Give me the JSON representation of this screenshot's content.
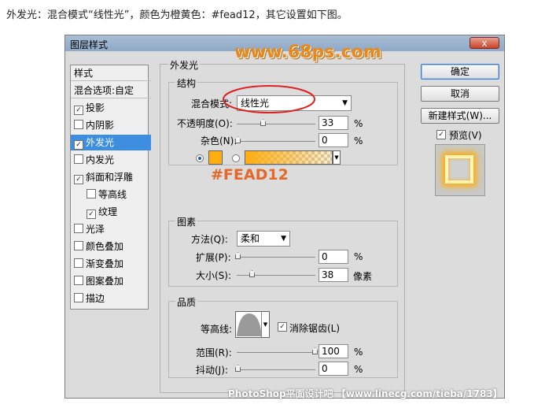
{
  "caption": "外发光：混合模式“线性光”，颜色为橙黄色：#fead12，其它设置如下图。",
  "dialog": {
    "title": "图层样式",
    "close_label": "x"
  },
  "sidebar": {
    "header": "样式",
    "blend_options": "混合选项:自定",
    "items": [
      {
        "label": "投影",
        "checked": "✓"
      },
      {
        "label": "内阴影",
        "checked": ""
      },
      {
        "label": "外发光",
        "checked": "✓"
      },
      {
        "label": "内发光",
        "checked": ""
      },
      {
        "label": "斜面和浮雕",
        "checked": "✓"
      },
      {
        "label": "等高线",
        "checked": ""
      },
      {
        "label": "纹理",
        "checked": "✓"
      },
      {
        "label": "光泽",
        "checked": ""
      },
      {
        "label": "颜色叠加",
        "checked": ""
      },
      {
        "label": "渐变叠加",
        "checked": ""
      },
      {
        "label": "图案叠加",
        "checked": ""
      },
      {
        "label": "描边",
        "checked": ""
      }
    ]
  },
  "panel": {
    "title": "外发光",
    "structure": {
      "title": "结构",
      "blend_mode_label": "混合模式:",
      "blend_mode_value": "线性光",
      "opacity_label": "不透明度(O):",
      "opacity_value": "33",
      "noise_label": "杂色(N):",
      "noise_value": "0",
      "percent": "%"
    },
    "elements": {
      "title": "图素",
      "method_label": "方法(Q):",
      "method_value": "柔和",
      "spread_label": "扩展(P):",
      "spread_value": "0",
      "size_label": "大小(S):",
      "size_value": "38",
      "px_unit": "像素",
      "percent": "%"
    },
    "quality": {
      "title": "品质",
      "contour_label": "等高线:",
      "antialias_label": "消除锯齿(L)",
      "range_label": "范围(R):",
      "range_value": "100",
      "jitter_label": "抖动(J):",
      "jitter_value": "0",
      "percent": "%"
    }
  },
  "buttons": {
    "ok": "确定",
    "cancel": "取消",
    "new_style": "新建样式(W)...",
    "preview": "预览(V)"
  },
  "overlays": {
    "site_watermark": "www.68ps.com",
    "color_note": "#FEAD12",
    "bottom_watermark": "PhotoShop平面设计吧 【www.linecg.com/tieba/1783】"
  },
  "colors": {
    "glow": "#fead12",
    "selected": "#3d8ee0"
  }
}
